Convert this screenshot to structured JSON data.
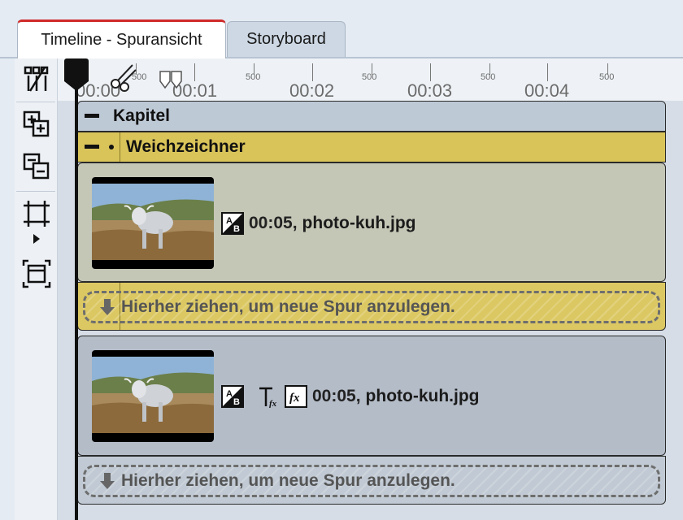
{
  "tabs": [
    {
      "label": "Timeline - Spuransicht",
      "active": true
    },
    {
      "label": "Storyboard",
      "active": false
    }
  ],
  "ruler": {
    "major_labels": [
      "00:00",
      "00:01",
      "00:02",
      "00:03",
      "00:04"
    ],
    "minor_label": "500"
  },
  "toolbar": {
    "icons": [
      "auto-cut-icon",
      "expand-all-icon",
      "collapse-all-icon",
      "fit-icon",
      "zoom-fit-icon"
    ]
  },
  "tracks": {
    "chapter": {
      "title": "Kapitel"
    },
    "effect": {
      "title": "Weichzeichner"
    },
    "clip1": {
      "duration": "00:05,",
      "filename": "photo-kuh.jpg"
    },
    "drop1": {
      "text": "Hierher ziehen, um neue Spur anzulegen."
    },
    "clip2": {
      "duration": "00:05,",
      "filename": "photo-kuh.jpg"
    },
    "drop2": {
      "text": "Hierher ziehen, um neue Spur anzulegen."
    }
  },
  "colors": {
    "active_tab_accent": "#d02a2a",
    "effect_track": "#d9c45a",
    "clip_track": "#b4bcc8"
  }
}
